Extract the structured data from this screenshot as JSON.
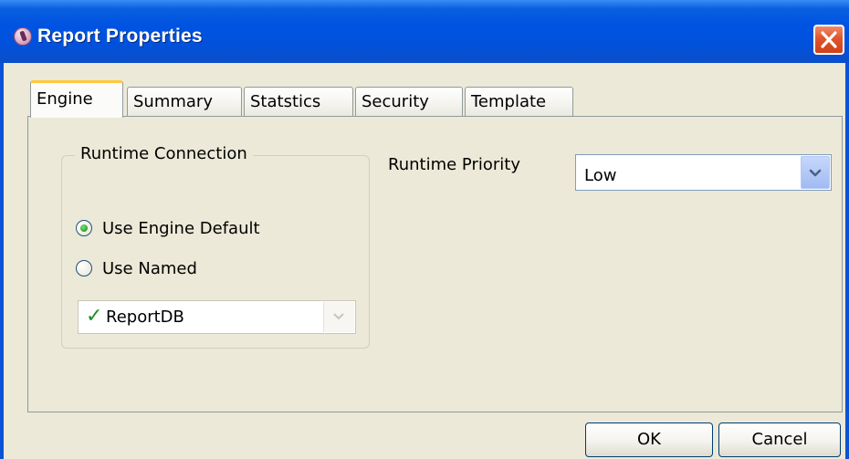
{
  "window": {
    "title": "Report Properties"
  },
  "tabs": [
    {
      "label": "Engine",
      "active": true
    },
    {
      "label": "Summary",
      "active": false
    },
    {
      "label": "Statstics",
      "active": false
    },
    {
      "label": "Security",
      "active": false
    },
    {
      "label": "Template",
      "active": false
    }
  ],
  "engine": {
    "runtime_connection": {
      "legend": "Runtime Connection",
      "options": [
        {
          "label": "Use Engine Default",
          "checked": true
        },
        {
          "label": "Use Named",
          "checked": false
        }
      ],
      "named_value": "ReportDB"
    },
    "runtime_priority": {
      "label": "Runtime Priority",
      "value": "Low"
    }
  },
  "buttons": {
    "ok": "OK",
    "cancel": "Cancel"
  },
  "icons": {
    "app": "app-icon",
    "close": "close-icon",
    "valid": "checkmark-icon",
    "dropdown": "chevron-down-icon"
  },
  "colors": {
    "titlebar": "#0053e1",
    "close": "#e0552c",
    "active_tab_accent": "#ffc83c",
    "dialog_bg": "#ece9d8"
  }
}
